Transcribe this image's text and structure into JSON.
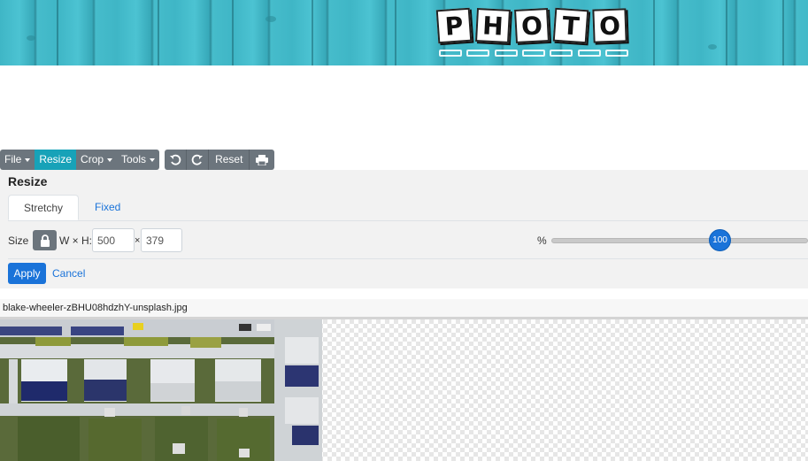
{
  "banner": {
    "logo_letters": [
      "P",
      "H",
      "O",
      "T",
      "O"
    ],
    "logo_subtitle_icon": "resizer-wordmark"
  },
  "toolbar": {
    "file_label": "File",
    "resize_label": "Resize",
    "crop_label": "Crop",
    "tools_label": "Tools",
    "undo_icon": "undo-icon",
    "redo_icon": "redo-icon",
    "reset_label": "Reset",
    "print_icon": "print-icon",
    "active_color": "#17a2b8",
    "button_color": "#6c757d"
  },
  "panel": {
    "title": "Resize",
    "tabs": [
      {
        "label": "Stretchy",
        "active": true
      },
      {
        "label": "Fixed",
        "active": false
      }
    ],
    "size_label": "Size",
    "lock_icon": "lock-icon",
    "wh_label": "W × H:",
    "width_value": "500",
    "times_sign": "×",
    "height_value": "379",
    "percent_label": "%",
    "slider_value": "100",
    "apply_label": "Apply",
    "cancel_label": "Cancel",
    "primary_color": "#1a73d9"
  },
  "file": {
    "name": "blake-wheeler-zBHU08hdzhY-unsplash.jpg"
  }
}
